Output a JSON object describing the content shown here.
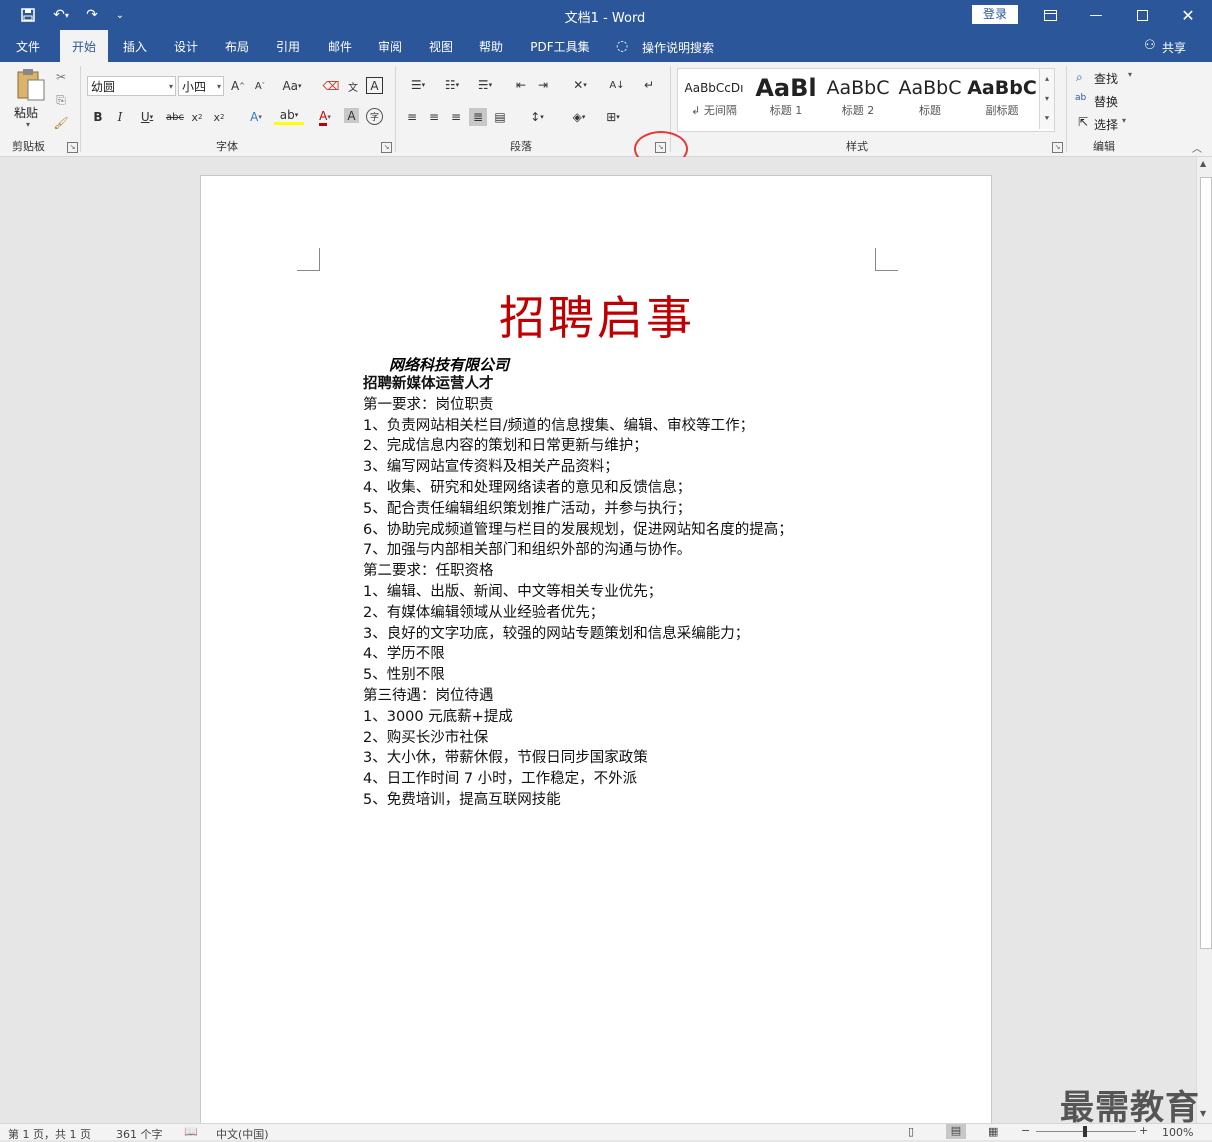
{
  "window": {
    "title": "文档1  -  Word",
    "login_label": "登录",
    "share_label": "共享"
  },
  "tabs": [
    "文件",
    "开始",
    "插入",
    "设计",
    "布局",
    "引用",
    "邮件",
    "审阅",
    "视图",
    "帮助",
    "PDF工具集"
  ],
  "tell_me": "操作说明搜索",
  "ribbon": {
    "clipboard": {
      "paste_label": "粘贴",
      "group_label": "剪贴板"
    },
    "font": {
      "name": "幼圆",
      "size": "小四",
      "group_label": "字体"
    },
    "paragraph": {
      "group_label": "段落"
    },
    "styles": {
      "group_label": "样式",
      "items": [
        {
          "sample": "AaBbCcDı",
          "name": "↲ 无间隔"
        },
        {
          "sample": "AaBl",
          "name": "标题 1"
        },
        {
          "sample": "AaBbC",
          "name": "标题 2"
        },
        {
          "sample": "AaBbC",
          "name": "标题"
        },
        {
          "sample": "AaBbC",
          "name": "副标题"
        }
      ]
    },
    "editing": {
      "find": "查找",
      "replace": "替换",
      "select": "选择",
      "group_label": "编辑"
    }
  },
  "document": {
    "title": "招聘启事",
    "company": "网络科技有限公司",
    "lines": [
      {
        "text": "招聘新媒体运营人才",
        "bold": true
      },
      {
        "text": "第一要求：岗位职责"
      },
      {
        "text": "1、负责网站相关栏目/频道的信息搜集、编辑、审校等工作；"
      },
      {
        "text": "2、完成信息内容的策划和日常更新与维护；"
      },
      {
        "text": "3、编写网站宣传资料及相关产品资料；"
      },
      {
        "text": "4、收集、研究和处理网络读者的意见和反馈信息；"
      },
      {
        "text": "5、配合责任编辑组织策划推广活动，并参与执行；"
      },
      {
        "text": "6、协助完成频道管理与栏目的发展规划，促进网站知名度的提高；"
      },
      {
        "text": "7、加强与内部相关部门和组织外部的沟通与协作。"
      },
      {
        "text": "第二要求：任职资格"
      },
      {
        "text": "1、编辑、出版、新闻、中文等相关专业优先；"
      },
      {
        "text": "2、有媒体编辑领域从业经验者优先；"
      },
      {
        "text": "3、良好的文字功底，较强的网站专题策划和信息采编能力；"
      },
      {
        "text": "4、学历不限"
      },
      {
        "text": "5、性别不限"
      },
      {
        "text": "第三待遇：岗位待遇"
      },
      {
        "text": "1、3000 元底薪+提成"
      },
      {
        "text": "2、购买长沙市社保"
      },
      {
        "text": "3、大小休，带薪休假，节假日同步国家政策"
      },
      {
        "text": "4、日工作时间 7 小时，工作稳定，不外派"
      },
      {
        "text": "5、免费培训，提高互联网技能"
      }
    ]
  },
  "status": {
    "page": "第 1 页，共 1 页",
    "words": "361 个字",
    "language": "中文(中国)",
    "zoom": "100%"
  },
  "watermark": "最需教育",
  "colors": {
    "brand": "#2b579a",
    "title_red": "#c00000",
    "highlight_circle": "#e53935"
  }
}
